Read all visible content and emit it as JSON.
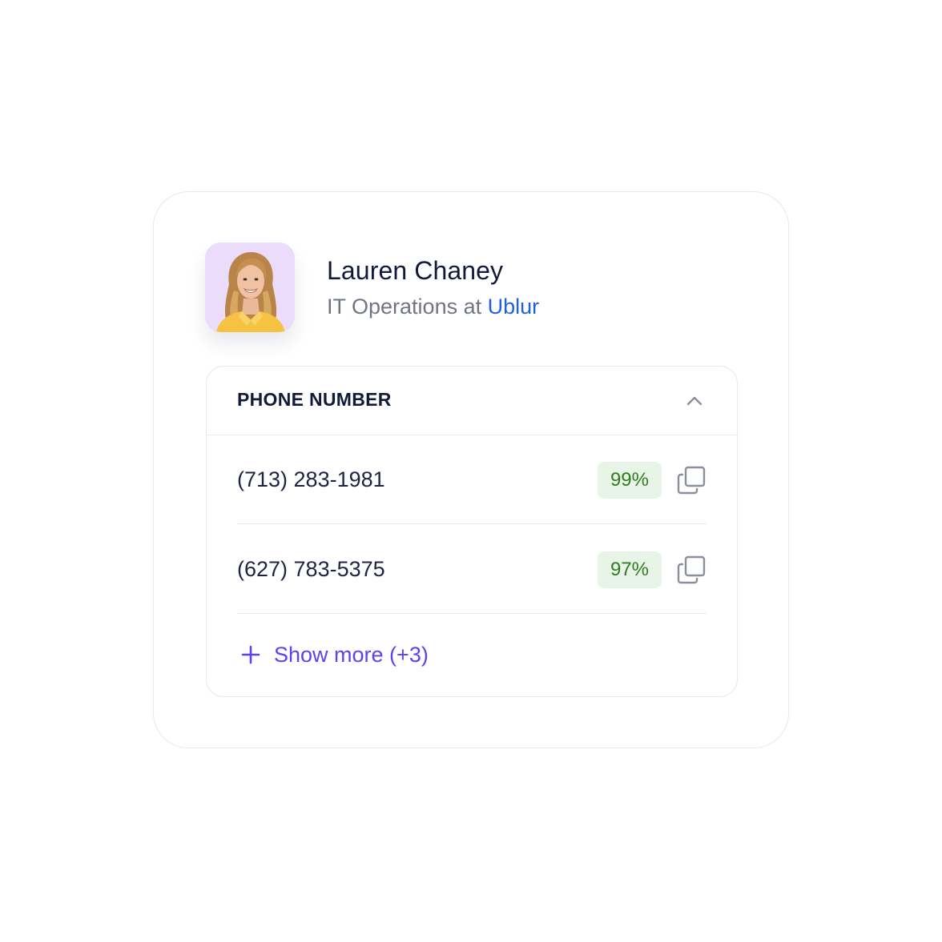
{
  "profile": {
    "name": "Lauren Chaney",
    "role_prefix": "IT Operations at ",
    "company": "Ublur",
    "avatar_icon": "person-photo"
  },
  "panel": {
    "title": "PHONE NUMBER",
    "toggle_icon": "chevron-up-icon",
    "rows": [
      {
        "phone": "(713) 283-1981",
        "confidence": "99%",
        "action_icon": "copy-icon"
      },
      {
        "phone": "(627) 783-5375",
        "confidence": "97%",
        "action_icon": "copy-icon"
      }
    ],
    "show_more": "Show more (+3)"
  },
  "colors": {
    "accent": "#5b42f3",
    "company_link": "#1f5fe0",
    "badge_bg": "#e8f4e7",
    "badge_text": "#2e7d1e",
    "avatar_bg": "#ecdcfb"
  }
}
